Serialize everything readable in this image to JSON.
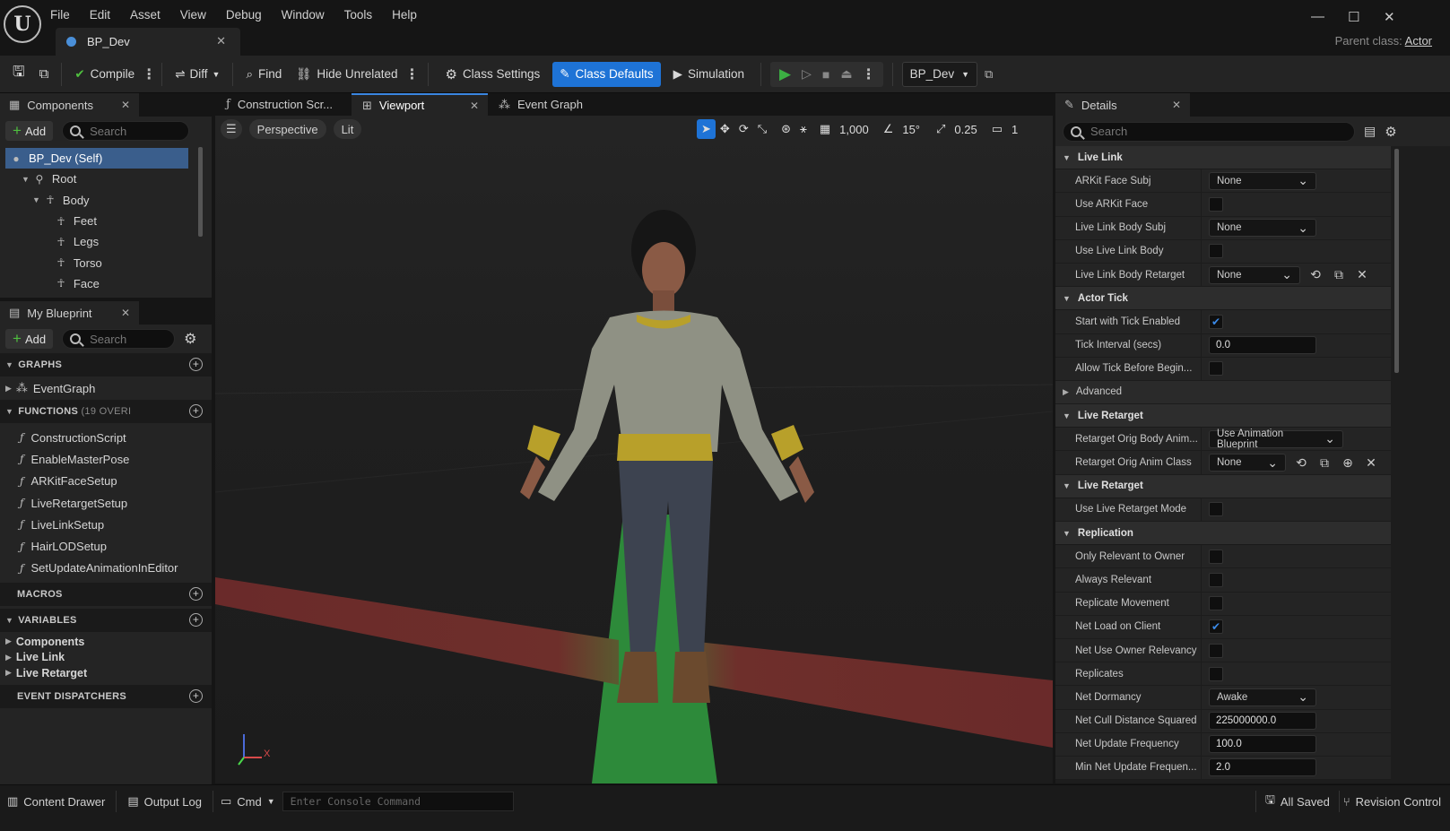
{
  "menu": [
    "File",
    "Edit",
    "Asset",
    "View",
    "Debug",
    "Window",
    "Tools",
    "Help"
  ],
  "doc_tab": "BP_Dev",
  "parent_class_label": "Parent class:",
  "parent_class_value": "Actor",
  "toolbar": {
    "compile": "Compile",
    "diff": "Diff",
    "find": "Find",
    "hide_unrelated": "Hide Unrelated",
    "class_settings": "Class Settings",
    "class_defaults": "Class Defaults",
    "simulation": "Simulation",
    "debug_object": "BP_Dev"
  },
  "components": {
    "title": "Components",
    "add": "Add",
    "search_placeholder": "Search",
    "tree": [
      {
        "label": "BP_Dev (Self)",
        "depth": 0,
        "selected": true
      },
      {
        "label": "Root",
        "depth": 1
      },
      {
        "label": "Body",
        "depth": 2
      },
      {
        "label": "Feet",
        "depth": 3
      },
      {
        "label": "Legs",
        "depth": 3
      },
      {
        "label": "Torso",
        "depth": 3
      },
      {
        "label": "Face",
        "depth": 3
      }
    ]
  },
  "my_blueprint": {
    "title": "My Blueprint",
    "add": "Add",
    "search_placeholder": "Search",
    "graphs_header": "GRAPHS",
    "graphs": [
      "EventGraph"
    ],
    "functions_header": "FUNCTIONS",
    "functions_count": "(19 OVERI",
    "functions": [
      "ConstructionScript",
      "EnableMasterPose",
      "ARKitFaceSetup",
      "LiveRetargetSetup",
      "LiveLinkSetup",
      "HairLODSetup",
      "SetUpdateAnimationInEditor"
    ],
    "macros_header": "MACROS",
    "variables_header": "VARIABLES",
    "variables": [
      "Components",
      "Live Link",
      "Live Retarget"
    ],
    "dispatchers_header": "EVENT DISPATCHERS"
  },
  "center_tabs": [
    "Construction Scr...",
    "Viewport",
    "Event Graph"
  ],
  "viewport": {
    "perspective": "Perspective",
    "lit": "Lit",
    "grid": "1,000",
    "angle": "15°",
    "scale": "0.25",
    "camera_speed": "1",
    "axis_x": "X"
  },
  "details": {
    "title": "Details",
    "search_placeholder": "Search",
    "sections": [
      {
        "title": "Live Link",
        "rows": [
          {
            "name": "ARKit Face Subj",
            "type": "dropdown",
            "value": "None"
          },
          {
            "name": "Use ARKit Face",
            "type": "check",
            "checked": false
          },
          {
            "name": "Live Link Body Subj",
            "type": "dropdown",
            "value": "None"
          },
          {
            "name": "Use Live Link Body",
            "type": "check",
            "checked": false
          },
          {
            "name": "Live Link Body Retarget",
            "type": "dropdown3",
            "value": "None"
          }
        ]
      },
      {
        "title": "Actor Tick",
        "rows": [
          {
            "name": "Start with Tick Enabled",
            "type": "check",
            "checked": true
          },
          {
            "name": "Tick Interval (secs)",
            "type": "text",
            "value": "0.0"
          },
          {
            "name": "Allow Tick Before Begin...",
            "type": "check",
            "checked": false
          },
          {
            "name": "Advanced",
            "type": "advanced"
          }
        ]
      },
      {
        "title": "Live Retarget",
        "rows": [
          {
            "name": "Retarget Orig Body Anim...",
            "type": "dropdownWide",
            "value": "Use Animation Blueprint"
          },
          {
            "name": "Retarget Orig Anim Class",
            "type": "dropdown4",
            "value": "None"
          }
        ]
      },
      {
        "title": "Live Retarget",
        "rows": [
          {
            "name": "Use Live Retarget Mode",
            "type": "check",
            "checked": false
          }
        ]
      },
      {
        "title": "Replication",
        "rows": [
          {
            "name": "Only Relevant to Owner",
            "type": "check",
            "checked": false
          },
          {
            "name": "Always Relevant",
            "type": "check",
            "checked": false
          },
          {
            "name": "Replicate Movement",
            "type": "check",
            "checked": false
          },
          {
            "name": "Net Load on Client",
            "type": "check",
            "checked": true
          },
          {
            "name": "Net Use Owner Relevancy",
            "type": "check",
            "checked": false
          },
          {
            "name": "Replicates",
            "type": "check",
            "checked": false
          },
          {
            "name": "Net Dormancy",
            "type": "dropdown",
            "value": "Awake"
          },
          {
            "name": "Net Cull Distance Squared",
            "type": "text",
            "value": "225000000.0"
          },
          {
            "name": "Net Update Frequency",
            "type": "text",
            "value": "100.0"
          },
          {
            "name": "Min Net Update Frequen...",
            "type": "text",
            "value": "2.0"
          }
        ]
      }
    ]
  },
  "statusbar": {
    "content_drawer": "Content Drawer",
    "output_log": "Output Log",
    "cmd": "Cmd",
    "console_placeholder": "Enter Console Command",
    "all_saved": "All Saved",
    "revision_control": "Revision Control"
  },
  "colors": {
    "accent": "#1e73d6",
    "selected_row": "#3a5e8c",
    "play_green": "#3cb043"
  }
}
